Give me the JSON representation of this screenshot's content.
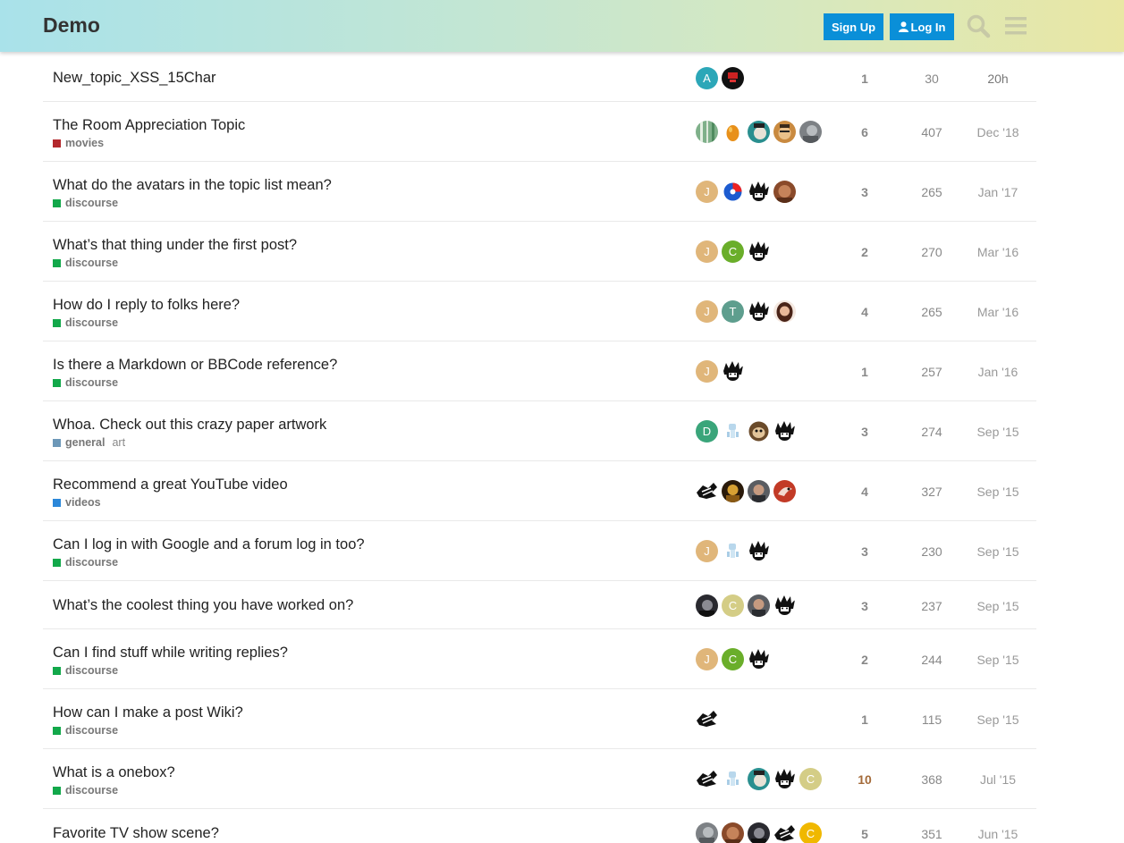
{
  "header": {
    "logo": "Demo",
    "signup_label": "Sign Up",
    "login_label": "Log In"
  },
  "colors": {
    "accent": "#0a8fd8",
    "movies": "#b3282d",
    "discourse": "#12a84a",
    "general": "#6d98b8",
    "videos": "#2b87d9"
  },
  "topics": [
    {
      "title": "New_topic_XSS_15Char",
      "category": "",
      "tag": "",
      "replies": "1",
      "views": "30",
      "activity": "20h",
      "posters": [
        {
          "type": "letter",
          "letter": "A",
          "color": "#2ca7b8"
        },
        {
          "type": "img",
          "icon": "dark-red-avatar"
        }
      ]
    },
    {
      "title": "The Room Appreciation Topic",
      "category": "movies",
      "tag": "",
      "replies": "6",
      "views": "407",
      "activity": "Dec '18",
      "posters": [
        {
          "type": "img",
          "icon": "green-stripes-avatar"
        },
        {
          "type": "img",
          "icon": "orange-egg-avatar"
        },
        {
          "type": "img",
          "icon": "teal-face-avatar"
        },
        {
          "type": "img",
          "icon": "brown-face-avatar"
        },
        {
          "type": "img",
          "icon": "grey-photo-avatar"
        }
      ]
    },
    {
      "title": "What do the avatars in the topic list mean?",
      "category": "discourse",
      "tag": "",
      "replies": "3",
      "views": "265",
      "activity": "Jan '17",
      "posters": [
        {
          "type": "letter",
          "letter": "J",
          "color": "#e0b67a"
        },
        {
          "type": "img",
          "icon": "blue-red-ball-avatar"
        },
        {
          "type": "img",
          "icon": "spiky-avatar"
        },
        {
          "type": "img",
          "icon": "brown-portrait-avatar"
        }
      ]
    },
    {
      "title": "What’s that thing under the first post?",
      "category": "discourse",
      "tag": "",
      "replies": "2",
      "views": "270",
      "activity": "Mar '16",
      "posters": [
        {
          "type": "letter",
          "letter": "J",
          "color": "#e0b67a"
        },
        {
          "type": "letter",
          "letter": "C",
          "color": "#6aae2a"
        },
        {
          "type": "img",
          "icon": "spiky-avatar"
        }
      ]
    },
    {
      "title": "How do I reply to folks here?",
      "category": "discourse",
      "tag": "",
      "replies": "4",
      "views": "265",
      "activity": "Mar '16",
      "posters": [
        {
          "type": "letter",
          "letter": "J",
          "color": "#e0b67a"
        },
        {
          "type": "letter",
          "letter": "T",
          "color": "#5e9e8e"
        },
        {
          "type": "img",
          "icon": "spiky-avatar"
        },
        {
          "type": "img",
          "icon": "woman-portrait-avatar"
        }
      ]
    },
    {
      "title": "Is there a Markdown or BBCode reference?",
      "category": "discourse",
      "tag": "",
      "replies": "1",
      "views": "257",
      "activity": "Jan '16",
      "posters": [
        {
          "type": "letter",
          "letter": "J",
          "color": "#e0b67a"
        },
        {
          "type": "img",
          "icon": "spiky-avatar"
        }
      ]
    },
    {
      "title": "Whoa. Check out this crazy paper artwork",
      "category": "general",
      "tag": "art",
      "replies": "3",
      "views": "274",
      "activity": "Sep '15",
      "posters": [
        {
          "type": "letter",
          "letter": "D",
          "color": "#3aa57a"
        },
        {
          "type": "img",
          "icon": "robot-avatar"
        },
        {
          "type": "img",
          "icon": "sloth-avatar"
        },
        {
          "type": "img",
          "icon": "spiky-avatar"
        }
      ]
    },
    {
      "title": "Recommend a great YouTube video",
      "category": "videos",
      "tag": "",
      "replies": "4",
      "views": "327",
      "activity": "Sep '15",
      "posters": [
        {
          "type": "img",
          "icon": "sketch-avatar"
        },
        {
          "type": "img",
          "icon": "gold-portrait-avatar"
        },
        {
          "type": "img",
          "icon": "man-portrait-avatar"
        },
        {
          "type": "img",
          "icon": "red-bird-avatar"
        }
      ]
    },
    {
      "title": "Can I log in with Google and a forum log in too?",
      "category": "discourse",
      "tag": "",
      "replies": "3",
      "views": "230",
      "activity": "Sep '15",
      "posters": [
        {
          "type": "letter",
          "letter": "J",
          "color": "#e0b67a"
        },
        {
          "type": "img",
          "icon": "robot-avatar"
        },
        {
          "type": "img",
          "icon": "spiky-avatar"
        }
      ]
    },
    {
      "title": "What’s the coolest thing you have worked on?",
      "category": "",
      "tag": "",
      "replies": "3",
      "views": "237",
      "activity": "Sep '15",
      "posters": [
        {
          "type": "img",
          "icon": "dark-portrait-avatar"
        },
        {
          "type": "letter",
          "letter": "C",
          "color": "#d4cd86"
        },
        {
          "type": "img",
          "icon": "man-portrait-avatar"
        },
        {
          "type": "img",
          "icon": "spiky-avatar"
        }
      ]
    },
    {
      "title": "Can I find stuff while writing replies?",
      "category": "discourse",
      "tag": "",
      "replies": "2",
      "views": "244",
      "activity": "Sep '15",
      "posters": [
        {
          "type": "letter",
          "letter": "J",
          "color": "#e0b67a"
        },
        {
          "type": "letter",
          "letter": "C",
          "color": "#6aae2a"
        },
        {
          "type": "img",
          "icon": "spiky-avatar"
        }
      ]
    },
    {
      "title": "How can I make a post Wiki?",
      "category": "discourse",
      "tag": "",
      "replies": "1",
      "views": "115",
      "activity": "Sep '15",
      "posters": [
        {
          "type": "img",
          "icon": "sketch-avatar"
        }
      ]
    },
    {
      "title": "What is a onebox?",
      "category": "discourse",
      "tag": "",
      "replies": "10",
      "views": "368",
      "activity": "Jul '15",
      "posters": [
        {
          "type": "img",
          "icon": "sketch-avatar"
        },
        {
          "type": "img",
          "icon": "robot-avatar"
        },
        {
          "type": "img",
          "icon": "teal-face-avatar"
        },
        {
          "type": "img",
          "icon": "spiky-avatar"
        },
        {
          "type": "letter",
          "letter": "C",
          "color": "#d4cd86"
        }
      ]
    },
    {
      "title": "Favorite TV show scene?",
      "category": "",
      "tag": "",
      "replies": "5",
      "views": "351",
      "activity": "Jun '15",
      "posters": [
        {
          "type": "img",
          "icon": "grey-photo-avatar"
        },
        {
          "type": "img",
          "icon": "brown-portrait-avatar"
        },
        {
          "type": "img",
          "icon": "dark-portrait-avatar"
        },
        {
          "type": "img",
          "icon": "sketch-avatar"
        },
        {
          "type": "letter",
          "letter": "C",
          "color": "#f0b800"
        }
      ]
    }
  ]
}
